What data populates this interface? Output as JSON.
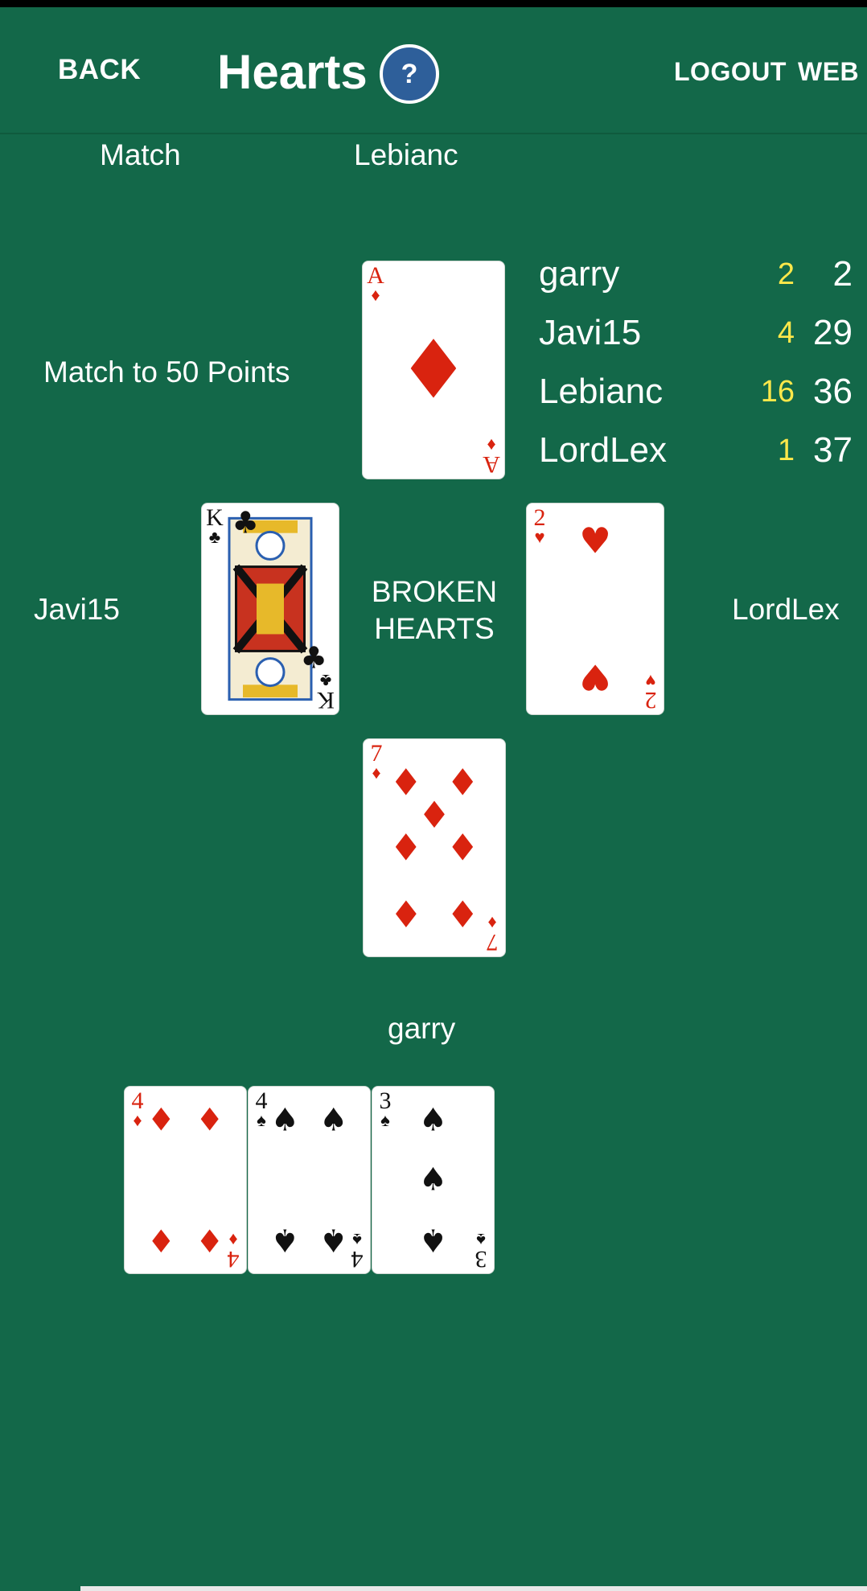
{
  "header": {
    "back_label": "BACK",
    "title": "Hearts",
    "help_label": "?",
    "logout_label": "LOGOUT",
    "web_label": "WEB"
  },
  "info": {
    "match_label": "Match",
    "leader_name": "Lebianc",
    "match_description": "Match to 50 Points"
  },
  "scoreboard": [
    {
      "name": "garry",
      "hand": "2",
      "total": "2"
    },
    {
      "name": "Javi15",
      "hand": "4",
      "total": "29"
    },
    {
      "name": "Lebianc",
      "hand": "16",
      "total": "36"
    },
    {
      "name": "LordLex",
      "hand": "1",
      "total": "37"
    }
  ],
  "table": {
    "left_player": "Javi15",
    "right_player": "LordLex",
    "bottom_player": "garry",
    "status_line1": "BROKEN",
    "status_line2": "HEARTS"
  },
  "trick": {
    "top": {
      "rank": "A",
      "suit": "♦"
    },
    "left": {
      "rank": "K",
      "suit": "♣"
    },
    "right": {
      "rank": "2",
      "suit": "♥"
    },
    "bottom": {
      "rank": "7",
      "suit": "♦"
    }
  },
  "hand": [
    {
      "rank": "4",
      "suit": "♦"
    },
    {
      "rank": "4",
      "suit": "♠"
    },
    {
      "rank": "3",
      "suit": "♠"
    }
  ],
  "colors": {
    "felt": "#136849",
    "red_suit": "#d9230f",
    "score_highlight": "#ffe84a",
    "help_button": "#2e5f9a"
  }
}
